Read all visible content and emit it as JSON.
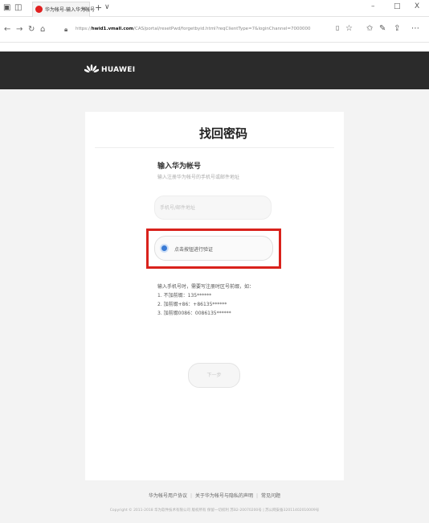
{
  "browser": {
    "tab_title": "华为帐号-输入华为帐号",
    "tab_close": "x",
    "new_tab": "+",
    "tab_dropdown": "∨",
    "window_min": "–",
    "window_restore": "□",
    "window_close": "X",
    "url_prefix": "https://",
    "url_host": "hwid1.vmall.com",
    "url_path": "/CAS/portal/resetPwd/forgetbyid.html?reqClientType=7&loginChannel=7000000"
  },
  "header": {
    "logo_text": "HUAWEI"
  },
  "card": {
    "title": "找回密码",
    "section_title": "输入华为帐号",
    "section_subtitle": "输入注册华为帐号的手机号或邮件地址",
    "account_placeholder": "手机号/邮件地址",
    "verify_label": "点击按钮进行验证",
    "hints": [
      "输入手机号时，需要写注册时区号前缀，如：",
      "1. 不加前缀：135******",
      "2. 加前缀+86：+86135******",
      "3. 加前缀0086：0086135******"
    ],
    "next_label": "下一步"
  },
  "footer": {
    "links": [
      "华为帐号用户协议",
      "关于华为帐号与隐私的声明",
      "常见问题"
    ],
    "copyright": "Copyright © 2011-2018 华为软件技术有限公司 版权所有 保留一切权利 苏B2-20070200号 | 苏公网安备32011402010009号"
  },
  "colors": {
    "header_bg": "#2b2b2b",
    "highlight": "#d9221c",
    "radio": "#3a7bd5"
  }
}
